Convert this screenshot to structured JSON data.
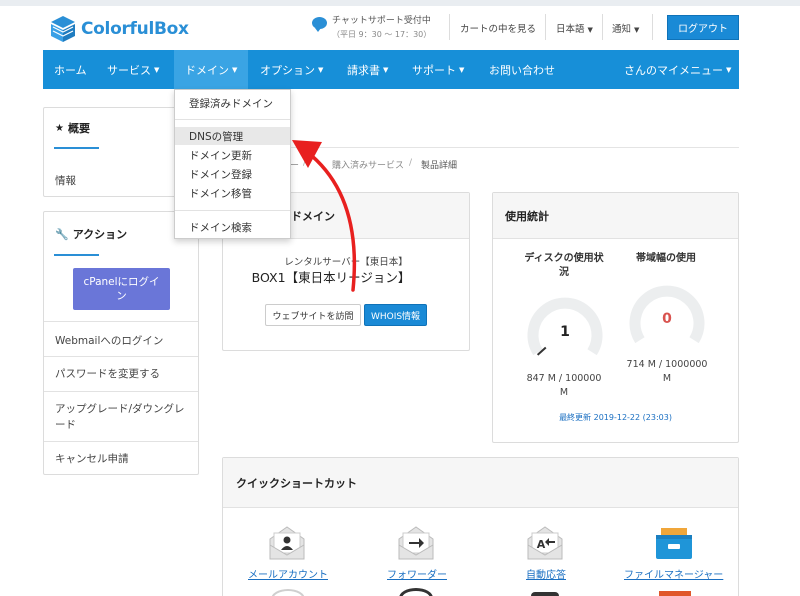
{
  "brand": {
    "name": "ColorfulBox",
    "accent": "#178fd8",
    "logout_color": "#1a8ad6"
  },
  "header": {
    "chat_title": "チャットサポート受付中",
    "chat_hours": "（平日 9：30 ～ 17：30）",
    "cart": "カートの中を見る",
    "language": "日本語",
    "notifications": "通知",
    "logout": "ログアウト"
  },
  "nav": {
    "home": "ホーム",
    "services": "サービス",
    "domains": "ドメイン",
    "options": "オプション",
    "invoices": "請求書",
    "support": "サポート",
    "contact": "お問い合わせ",
    "my_menu": "さんのマイメニュー"
  },
  "domain_menu": {
    "items": [
      "登録済みドメイン",
      "DNSの管理",
      "ドメイン更新",
      "ドメイン登録",
      "ドメイン移管",
      "ドメイン検索"
    ],
    "highlighted": "DNSの管理"
  },
  "sidebar": {
    "overview_title": "概要",
    "overview_item": "情報",
    "actions_title": "アクション",
    "cpanel_button": "cPanelにログイン",
    "actions": [
      "Webmailへのログイン",
      "パスワードを変更する",
      "アップグレード/ダウングレード",
      "キャンセル申請"
    ]
  },
  "breadcrumb": {
    "partial": "ー",
    "purchased": "購入済みサービス",
    "sep": "/",
    "current": "製品詳細"
  },
  "product": {
    "title_partial": "/ドメイン",
    "plan": "レンタルサーバー【東日本】",
    "name": "BOX1【東日本リージョン】",
    "visit_button": "ウェブサイトを訪問",
    "whois_button": "WHOIS情報"
  },
  "usage": {
    "title": "使用統計",
    "disk": {
      "label": "ディスクの使用状況",
      "value": "1",
      "amount": "847 M / 100000 M",
      "fraction": 0.01
    },
    "bandwidth": {
      "label": "帯域幅の使用",
      "value": "0",
      "amount": "714 M / 1000000 M",
      "fraction": 0.0,
      "value_color": "#d9534f"
    },
    "updated": "最終更新 2019-12-22 (23:03)"
  },
  "shortcuts": {
    "title": "クイックショートカット",
    "items": [
      {
        "label": "メールアカウント",
        "icon": "mail-account-icon"
      },
      {
        "label": "フォワーダー",
        "icon": "forwarder-icon"
      },
      {
        "label": "自動応答",
        "icon": "autoresponder-icon"
      },
      {
        "label": "ファイルマネージャー",
        "icon": "file-manager-icon"
      }
    ]
  }
}
